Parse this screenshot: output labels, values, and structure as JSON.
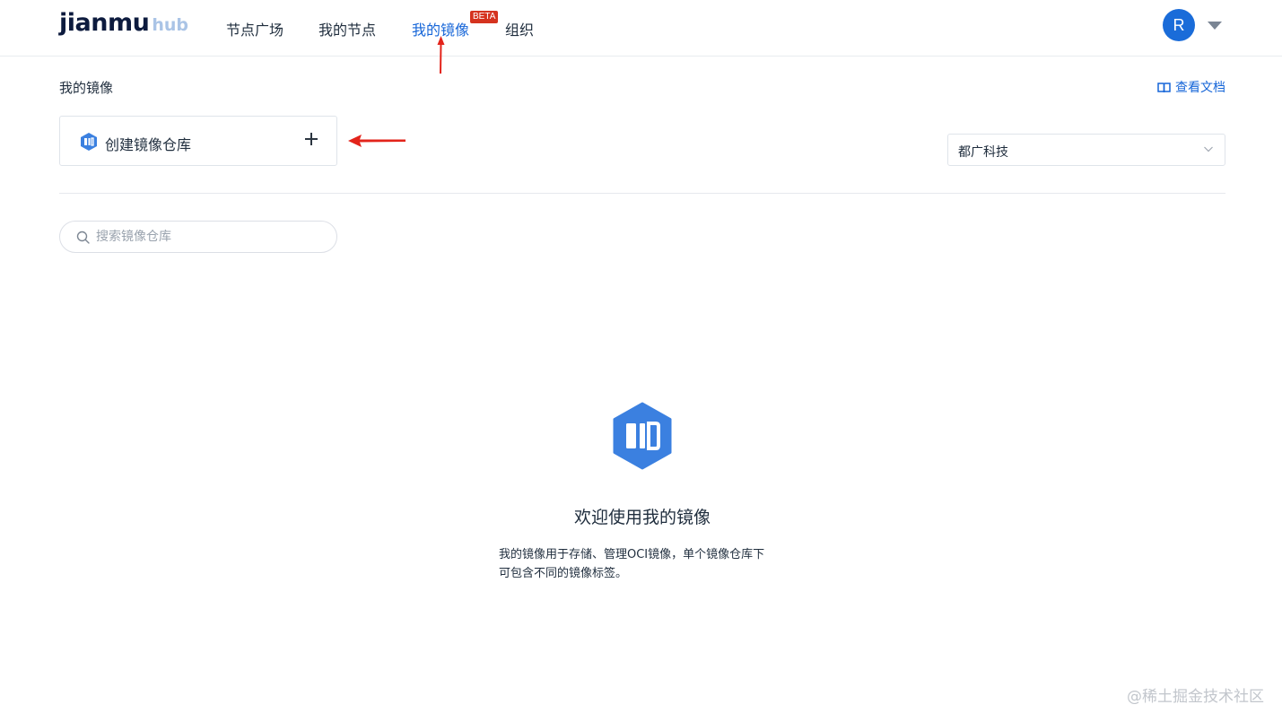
{
  "header": {
    "logo_main": "jianmu",
    "logo_sub": "hub",
    "nav": [
      {
        "label": "节点广场"
      },
      {
        "label": "我的节点"
      },
      {
        "label": "我的镜像"
      },
      {
        "label": "组织"
      }
    ],
    "active_nav": "我的镜像",
    "beta_badge": "BETA",
    "avatar_initial": "R"
  },
  "page": {
    "title": "我的镜像",
    "docs_link": "查看文档",
    "create_label": "创建镜像仓库",
    "org_select_value": "都广科技",
    "search_placeholder": "搜索镜像仓库"
  },
  "empty_state": {
    "title": "欢迎使用我的镜像",
    "desc_line1": "我的镜像用于存储、管理OCI镜像，单个镜像仓库下",
    "desc_line2": "可包含不同的镜像标签。"
  },
  "watermark": "@稀土掘金技术社区",
  "colors": {
    "accent": "#1565d8",
    "badge": "#d5331f",
    "avatar": "#1a6cd9",
    "icon_blue": "#3b80e0",
    "annotation_red": "#e3241b"
  },
  "icons": {
    "image_repo": "hexagon-image-icon",
    "docs": "book-icon",
    "search": "search-icon",
    "add": "plus-icon",
    "dropdown": "chevron-down-icon"
  }
}
